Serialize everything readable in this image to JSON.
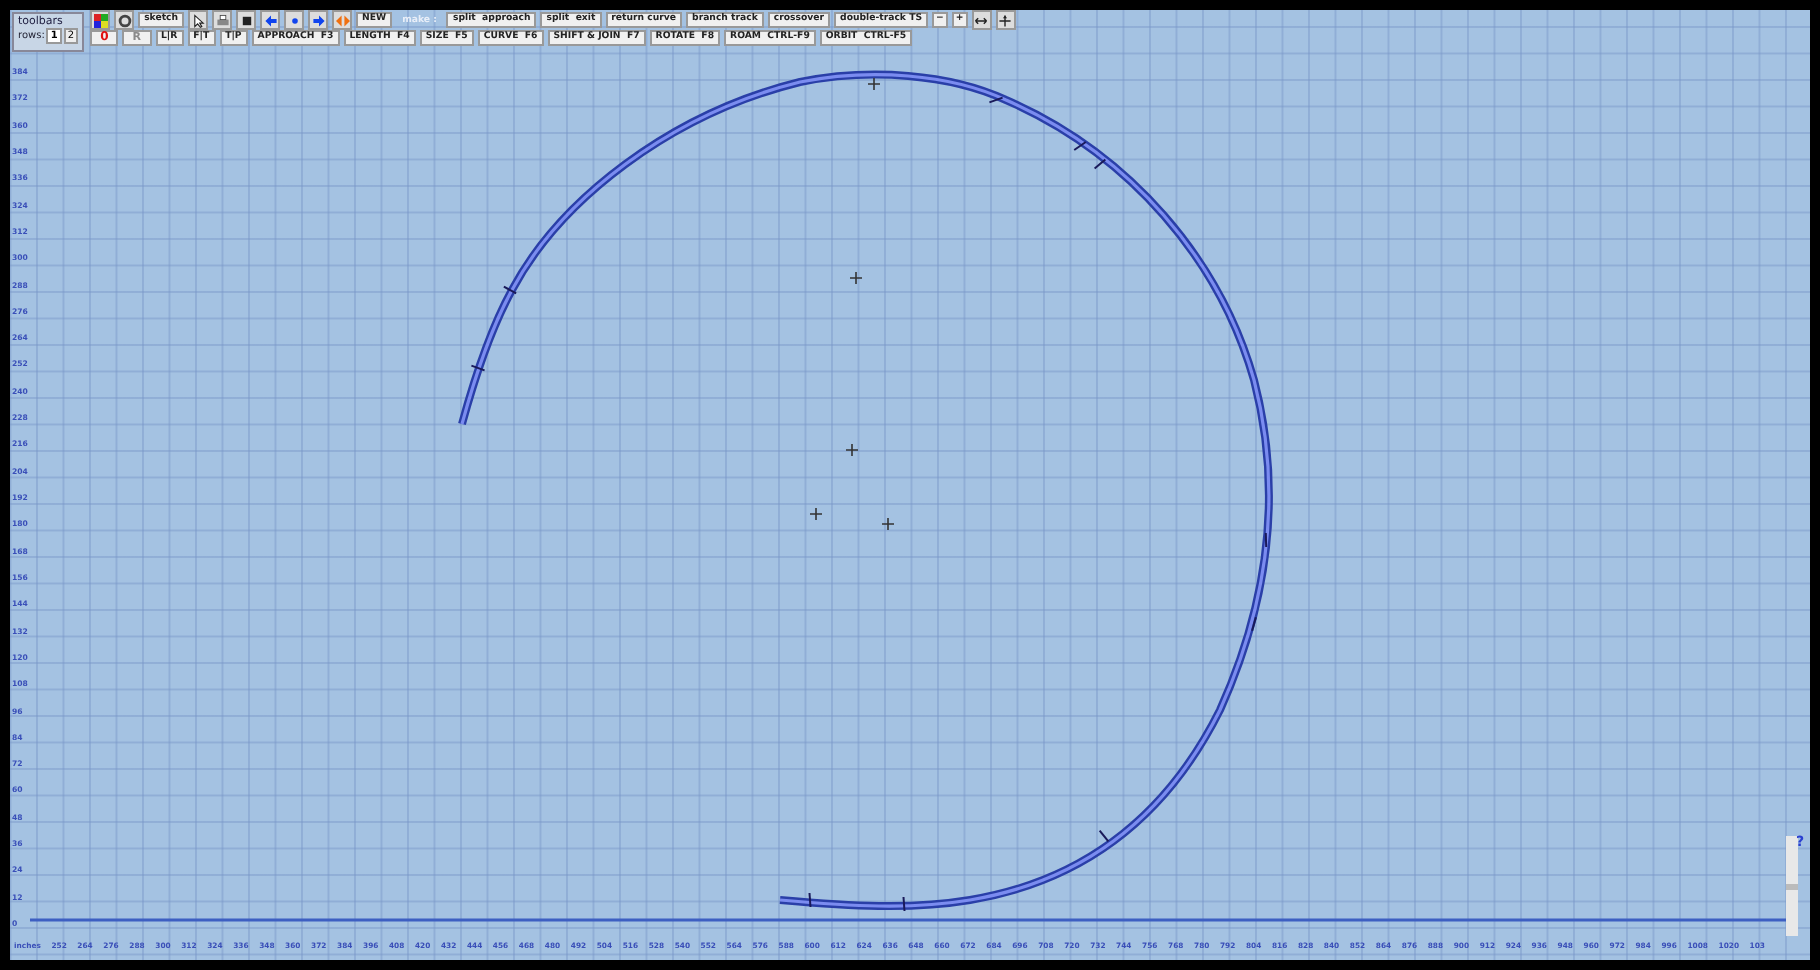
{
  "toolbars": {
    "title": "toolbars",
    "rows_label": "rows:",
    "rows": [
      {
        "label": "1",
        "selected": true
      },
      {
        "label": "2",
        "selected": false
      }
    ]
  },
  "toolbar_row_1": {
    "sketch": "sketch",
    "new": "NEW",
    "make_label": {
      "label": "make :",
      "disabled": true
    },
    "make_buttons": [
      "split  approach",
      "split  exit",
      "return curve",
      "branch track",
      "crossover",
      "double-track TS"
    ],
    "zoom_buttons": [
      "−",
      "+"
    ]
  },
  "toolbar_row_2": [
    {
      "label": "0",
      "kind": "red"
    },
    {
      "label": "R",
      "kind": "disabled"
    },
    {
      "label": "L|R",
      "kind": "plain"
    },
    {
      "label": "F|T",
      "kind": "plain"
    },
    {
      "label": "T|P",
      "kind": "plain"
    },
    {
      "label": "APPROACH  F3",
      "kind": "plain"
    },
    {
      "label": "LENGTH  F4",
      "kind": "plain"
    },
    {
      "label": "SIZE  F5",
      "kind": "plain"
    },
    {
      "label": "CURVE  F6",
      "kind": "plain"
    },
    {
      "label": "SHIFT & JOIN  F7",
      "kind": "plain"
    },
    {
      "label": "ROTATE  F8",
      "kind": "plain"
    },
    {
      "label": "ROAM  CTRL-F9",
      "kind": "plain"
    },
    {
      "label": "ORBIT  CTRL-F5",
      "kind": "plain"
    }
  ],
  "y_ruler": [
    "384",
    "372",
    "360",
    "348",
    "336",
    "324",
    "312",
    "300",
    "288",
    "276",
    "264",
    "252",
    "240",
    "228",
    "216",
    "204",
    "192",
    "180",
    "168",
    "156",
    "144",
    "132",
    "120",
    "108",
    "96",
    "84",
    "72",
    "60",
    "48",
    "36",
    "24",
    "12",
    "0"
  ],
  "x_ruler": {
    "unit": "inches",
    "labels": [
      "252",
      "264",
      "276",
      "288",
      "300",
      "312",
      "324",
      "336",
      "348",
      "360",
      "372",
      "384",
      "396",
      "408",
      "420",
      "432",
      "444",
      "456",
      "468",
      "480",
      "492",
      "504",
      "516",
      "528",
      "540",
      "552",
      "564",
      "576",
      "588",
      "600",
      "612",
      "624",
      "636",
      "648",
      "660",
      "672",
      "684",
      "696",
      "708",
      "720",
      "732",
      "744",
      "756",
      "768",
      "780",
      "792",
      "804",
      "816",
      "828",
      "840",
      "852",
      "864",
      "876",
      "888",
      "900",
      "912",
      "924",
      "936",
      "948",
      "960",
      "972",
      "984",
      "996",
      "1008",
      "1020",
      "103"
    ]
  },
  "help": "?"
}
